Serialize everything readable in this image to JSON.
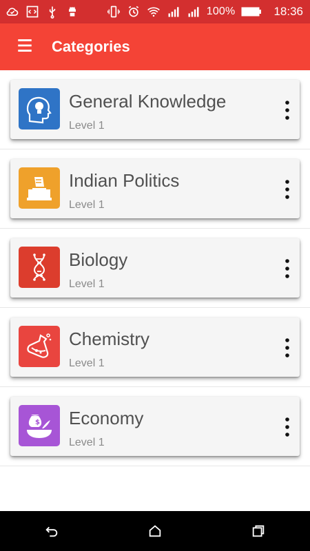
{
  "status_bar": {
    "left_icons": [
      "cloud-check-icon",
      "code-icon",
      "usb-icon",
      "android-icon"
    ],
    "right_icons": [
      "vibrate-icon",
      "alarm-icon",
      "wifi-icon",
      "signal-icon",
      "signal-2-icon"
    ],
    "battery_text": "100%",
    "time": "18:36",
    "bg_color": "#d32f2f"
  },
  "app_bar": {
    "title": "Categories",
    "menu_icon": "hamburger-menu-icon",
    "bg_color": "#f44336"
  },
  "categories": [
    {
      "title": "General Knowledge",
      "level": "Level 1",
      "icon": "head-lightbulb-icon",
      "icon_bg": "#2f74c6"
    },
    {
      "title": "Indian Politics",
      "level": "Level 1",
      "icon": "ballot-box-icon",
      "icon_bg": "#efa12b"
    },
    {
      "title": "Biology",
      "level": "Level 1",
      "icon": "dna-icon",
      "icon_bg": "#dc3d2d"
    },
    {
      "title": "Chemistry",
      "level": "Level 1",
      "icon": "flask-icon",
      "icon_bg": "#e9453f"
    },
    {
      "title": "Economy",
      "level": "Level 1",
      "icon": "money-bag-icon",
      "icon_bg": "#a755d6"
    }
  ],
  "nav_bar": {
    "buttons": [
      "back-icon",
      "home-icon",
      "recents-icon"
    ]
  }
}
